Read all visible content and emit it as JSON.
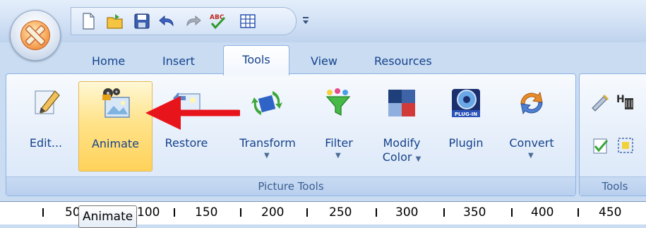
{
  "quick_access": {
    "icons": [
      "new-document-icon",
      "open-folder-icon",
      "save-icon",
      "undo-icon",
      "redo-icon",
      "spelling-check-icon",
      "table-icon"
    ],
    "dropdown": "customize-quick-access-icon"
  },
  "tabs": [
    {
      "label": "Home",
      "active": false
    },
    {
      "label": "Insert",
      "active": false
    },
    {
      "label": "Tools",
      "active": true
    },
    {
      "label": "View",
      "active": false
    },
    {
      "label": "Resources",
      "active": false
    }
  ],
  "groups": {
    "picture_tools": {
      "label": "Picture Tools",
      "buttons": [
        {
          "label": "Edit...",
          "icon": "pencil-edit-icon"
        },
        {
          "label": "Animate",
          "icon": "film-animate-icon",
          "highlighted": true
        },
        {
          "label": "Restore",
          "icon": "restore-picture-icon"
        },
        {
          "label": "Transform",
          "icon": "transform-arrows-icon",
          "dropdown": true
        },
        {
          "label": "Filter",
          "icon": "funnel-filter-icon",
          "dropdown": true
        },
        {
          "label": "Modify",
          "label2": "Color",
          "icon": "color-squares-icon",
          "dropdown": true
        },
        {
          "label": "Plugin",
          "icon": "plugin-cube-icon"
        },
        {
          "label": "Convert",
          "icon": "convert-arrows-icon",
          "dropdown": true
        }
      ]
    },
    "tools": {
      "label": "Tools"
    }
  },
  "ruler": {
    "labels": [
      "50",
      "100",
      "150",
      "200",
      "250",
      "300",
      "350",
      "400",
      "450"
    ]
  },
  "tooltip": {
    "text": "Animate"
  },
  "annotation": {
    "arrow_color": "#e8141b"
  },
  "colors": {
    "accent": "#15428b",
    "hover": "#ffd25a"
  }
}
